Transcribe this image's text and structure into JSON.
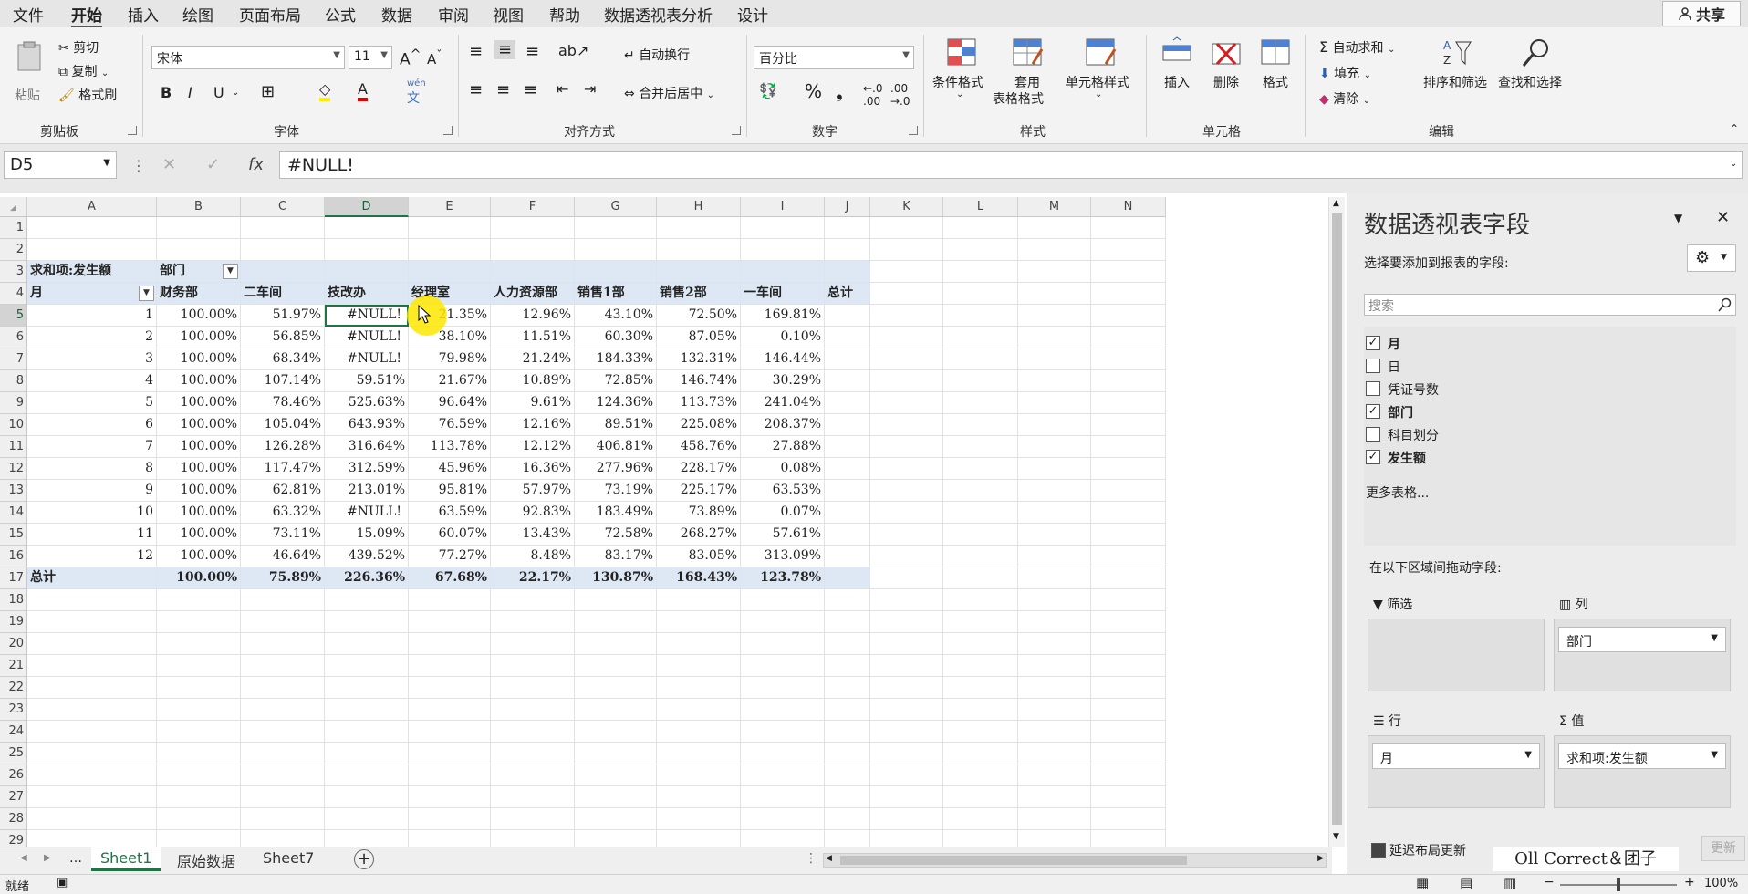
{
  "menu": {
    "tabs": [
      "文件",
      "开始",
      "插入",
      "绘图",
      "页面布局",
      "公式",
      "数据",
      "审阅",
      "视图",
      "帮助",
      "数据透视表分析",
      "设计"
    ],
    "share_label": "共享"
  },
  "ribbon": {
    "clipboard": {
      "paste": "粘贴",
      "cut": "剪切",
      "copy": "复制",
      "painter": "格式刷",
      "label": "剪贴板"
    },
    "font": {
      "name": "宋体",
      "size": "11",
      "label": "字体",
      "wen": "wén",
      "wen_char": "文"
    },
    "align": {
      "wrap": "自动换行",
      "merge": "合并后居中",
      "label": "对齐方式"
    },
    "number": {
      "format": "百分比",
      "label": "数字"
    },
    "styles": {
      "cond": "条件格式",
      "table_1": "套用",
      "table_2": "表格格式",
      "cell": "单元格样式",
      "label": "样式"
    },
    "cells": {
      "insert": "插入",
      "delete": "删除",
      "format": "格式",
      "label": "单元格"
    },
    "edit": {
      "autosum": "自动求和",
      "fill": "填充",
      "clear": "清除",
      "sort": "排序和筛选",
      "find": "查找和选择",
      "label": "编辑"
    }
  },
  "formula": {
    "namebox": "D5",
    "content": "#NULL!"
  },
  "columns": [
    "A",
    "B",
    "C",
    "D",
    "E",
    "F",
    "G",
    "H",
    "I",
    "J",
    "K",
    "L",
    "M",
    "N"
  ],
  "rows": [
    "1",
    "2",
    "3",
    "4",
    "5",
    "6",
    "7",
    "8",
    "9",
    "10",
    "11",
    "12",
    "13",
    "14",
    "15",
    "16",
    "17",
    "18",
    "19",
    "20",
    "21",
    "22",
    "23",
    "24",
    "25",
    "26",
    "27",
    "28",
    "29"
  ],
  "pivot_table": {
    "value_field": "求和项:发生额",
    "col_field": "部门",
    "row_field": "月",
    "headers": [
      "财务部",
      "二车间",
      "技改办",
      "经理室",
      "人力资源部",
      "销售1部",
      "销售2部",
      "一车间",
      "总计"
    ],
    "data": [
      [
        "1",
        "100.00%",
        "51.97%",
        "#NULL!",
        "21.35%",
        "12.96%",
        "43.10%",
        "72.50%",
        "169.81%"
      ],
      [
        "2",
        "100.00%",
        "56.85%",
        "#NULL!",
        "38.10%",
        "11.51%",
        "60.30%",
        "87.05%",
        "0.10%"
      ],
      [
        "3",
        "100.00%",
        "68.34%",
        "#NULL!",
        "79.98%",
        "21.24%",
        "184.33%",
        "132.31%",
        "146.44%"
      ],
      [
        "4",
        "100.00%",
        "107.14%",
        "59.51%",
        "21.67%",
        "10.89%",
        "72.85%",
        "146.74%",
        "30.29%"
      ],
      [
        "5",
        "100.00%",
        "78.46%",
        "525.63%",
        "96.64%",
        "9.61%",
        "124.36%",
        "113.73%",
        "241.04%"
      ],
      [
        "6",
        "100.00%",
        "105.04%",
        "643.93%",
        "76.59%",
        "12.16%",
        "89.51%",
        "225.08%",
        "208.37%"
      ],
      [
        "7",
        "100.00%",
        "126.28%",
        "316.64%",
        "113.78%",
        "12.12%",
        "406.81%",
        "458.76%",
        "27.88%"
      ],
      [
        "8",
        "100.00%",
        "117.47%",
        "312.59%",
        "45.96%",
        "16.36%",
        "277.96%",
        "228.17%",
        "0.08%"
      ],
      [
        "9",
        "100.00%",
        "62.81%",
        "213.01%",
        "95.81%",
        "57.97%",
        "73.19%",
        "225.17%",
        "63.53%"
      ],
      [
        "10",
        "100.00%",
        "63.32%",
        "#NULL!",
        "63.59%",
        "92.83%",
        "183.49%",
        "73.89%",
        "0.07%"
      ],
      [
        "11",
        "100.00%",
        "73.11%",
        "15.09%",
        "60.07%",
        "13.43%",
        "72.58%",
        "268.27%",
        "57.61%"
      ],
      [
        "12",
        "100.00%",
        "46.64%",
        "439.52%",
        "77.27%",
        "8.48%",
        "83.17%",
        "83.05%",
        "313.09%"
      ]
    ],
    "total_label": "总计",
    "totals": [
      "100.00%",
      "75.89%",
      "226.36%",
      "67.68%",
      "22.17%",
      "130.87%",
      "168.43%",
      "123.78%"
    ]
  },
  "sheet_tabs": [
    "Sheet1",
    "原始数据",
    "Sheet7"
  ],
  "status": {
    "ready": "就绪",
    "zoom": "100%"
  },
  "pivot_pane": {
    "title": "数据透视表字段",
    "subtitle": "选择要添加到报表的字段:",
    "search_placeholder": "搜索",
    "fields": [
      {
        "name": "月",
        "checked": true
      },
      {
        "name": "日",
        "checked": false
      },
      {
        "name": "凭证号数",
        "checked": false
      },
      {
        "name": "部门",
        "checked": true
      },
      {
        "name": "科目划分",
        "checked": false
      },
      {
        "name": "发生额",
        "checked": true
      }
    ],
    "more_tables": "更多表格...",
    "drag_hint": "在以下区域间拖动字段:",
    "zones": {
      "filter": "筛选",
      "columns": "列",
      "rows": "行",
      "values": "值"
    },
    "zone_items": {
      "columns": "部门",
      "rows": "月",
      "values": "求和项:发生额"
    },
    "defer": "延迟布局更新",
    "update": "更新"
  },
  "watermark": "Oll Correct＆团子",
  "colors": {
    "accent": "#217346",
    "band": "#dde8f4",
    "cursor": "#ffe600"
  }
}
